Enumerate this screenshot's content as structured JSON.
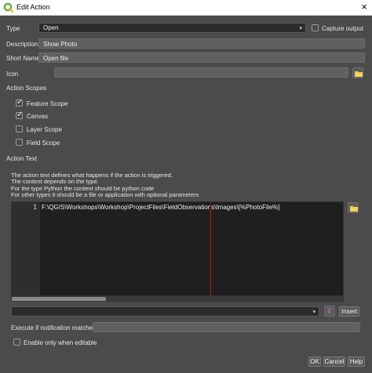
{
  "window": {
    "title": "Edit Action",
    "close_glyph": "×"
  },
  "form": {
    "type_label": "Type",
    "type_value": "Open",
    "capture_output_label": "Capture output",
    "capture_output_checked": false,
    "description_label": "Description",
    "description_value": "Show Photo",
    "short_name_label": "Short Name",
    "short_name_value": "Open file",
    "icon_label": "Icon",
    "icon_value": ""
  },
  "action_scopes": {
    "heading": "Action Scopes",
    "items": [
      {
        "label": "Feature Scope",
        "checked": true
      },
      {
        "label": "Canvas",
        "checked": true
      },
      {
        "label": "Layer Scope",
        "checked": false
      },
      {
        "label": "Field Scope",
        "checked": false
      }
    ]
  },
  "action_text": {
    "heading": "Action Text",
    "help_lines": [
      "The action text defines what happens if the action is triggered.",
      "The content depends on the type.",
      "For the type Python the content should be python code",
      "For other types it should be a file or application with optional parameters"
    ],
    "line_number": "1",
    "code": "F:\\QGIS\\Workshops\\Workshop\\ProjectFiles\\FieldObservations\\Images\\[%PhotoFile%]",
    "insert_button": "Insert",
    "field_combo_value": "",
    "expression_icon_glyph": "ε"
  },
  "notification": {
    "label": "Execute if notification matches",
    "value": ""
  },
  "enable_only_when_editable": {
    "label": "Enable only when editable",
    "checked": false
  },
  "footer": {
    "ok": "OK",
    "cancel": "Cancel",
    "help": "Help"
  },
  "icons": {
    "app_logo": "qgis-logo-icon",
    "folder": "folder-icon",
    "checkmark": "✓",
    "dropdown": "▾"
  },
  "colors": {
    "background": "#4b4b4b",
    "editor_background": "#1f1f1f",
    "edge_line": "#b01818",
    "qgis_green": "#5aa832",
    "folder_yellow": "#e8c44a"
  }
}
